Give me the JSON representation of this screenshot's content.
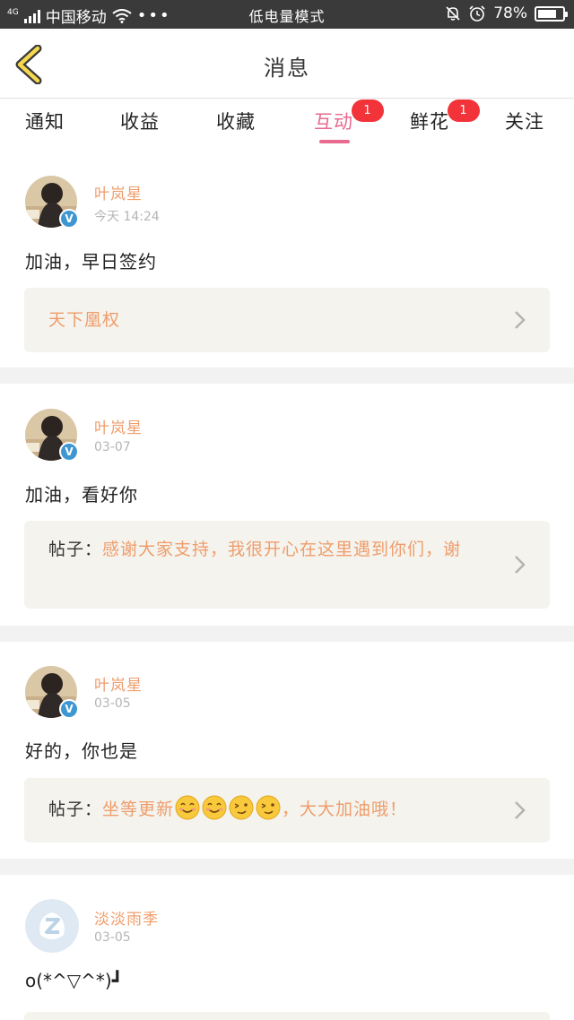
{
  "status": {
    "net": "4G",
    "carrier": "中国移动",
    "dots": "•••",
    "mode": "低电量模式",
    "battery_text": "78%",
    "battery_level": 0.78
  },
  "header": {
    "title": "消息"
  },
  "tabs": [
    {
      "label": "通知",
      "badge": ""
    },
    {
      "label": "收益",
      "badge": ""
    },
    {
      "label": "收藏",
      "badge": ""
    },
    {
      "label": "互动",
      "badge": "1",
      "active": true
    },
    {
      "label": "鲜花",
      "badge": "1"
    },
    {
      "label": "关注",
      "badge": ""
    }
  ],
  "messages": [
    {
      "user": "叶岚星",
      "time": "今天 14:24",
      "text": "加油，早日签约",
      "ref_label": "",
      "ref_text": "天下凰权"
    },
    {
      "user": "叶岚星",
      "time": "03-07",
      "text": "加油，看好你",
      "ref_label": "帖子：",
      "ref_text": "感谢大家支持，我很开心在这里遇到你们，谢"
    },
    {
      "user": "叶岚星",
      "time": "03-05",
      "text": "好的，你也是",
      "ref_label": "帖子：",
      "ref_text": "坐等更新",
      "ref_text2": "，大大加油哦！"
    },
    {
      "user": "淡淡雨季",
      "time": "03-05",
      "text": "o(*^▽^*)┛"
    }
  ],
  "colors": {
    "accent": "#e86a8e",
    "username": "#ef9d6b",
    "badge": "#f2333a",
    "ref_bg": "#f4f3ee"
  }
}
